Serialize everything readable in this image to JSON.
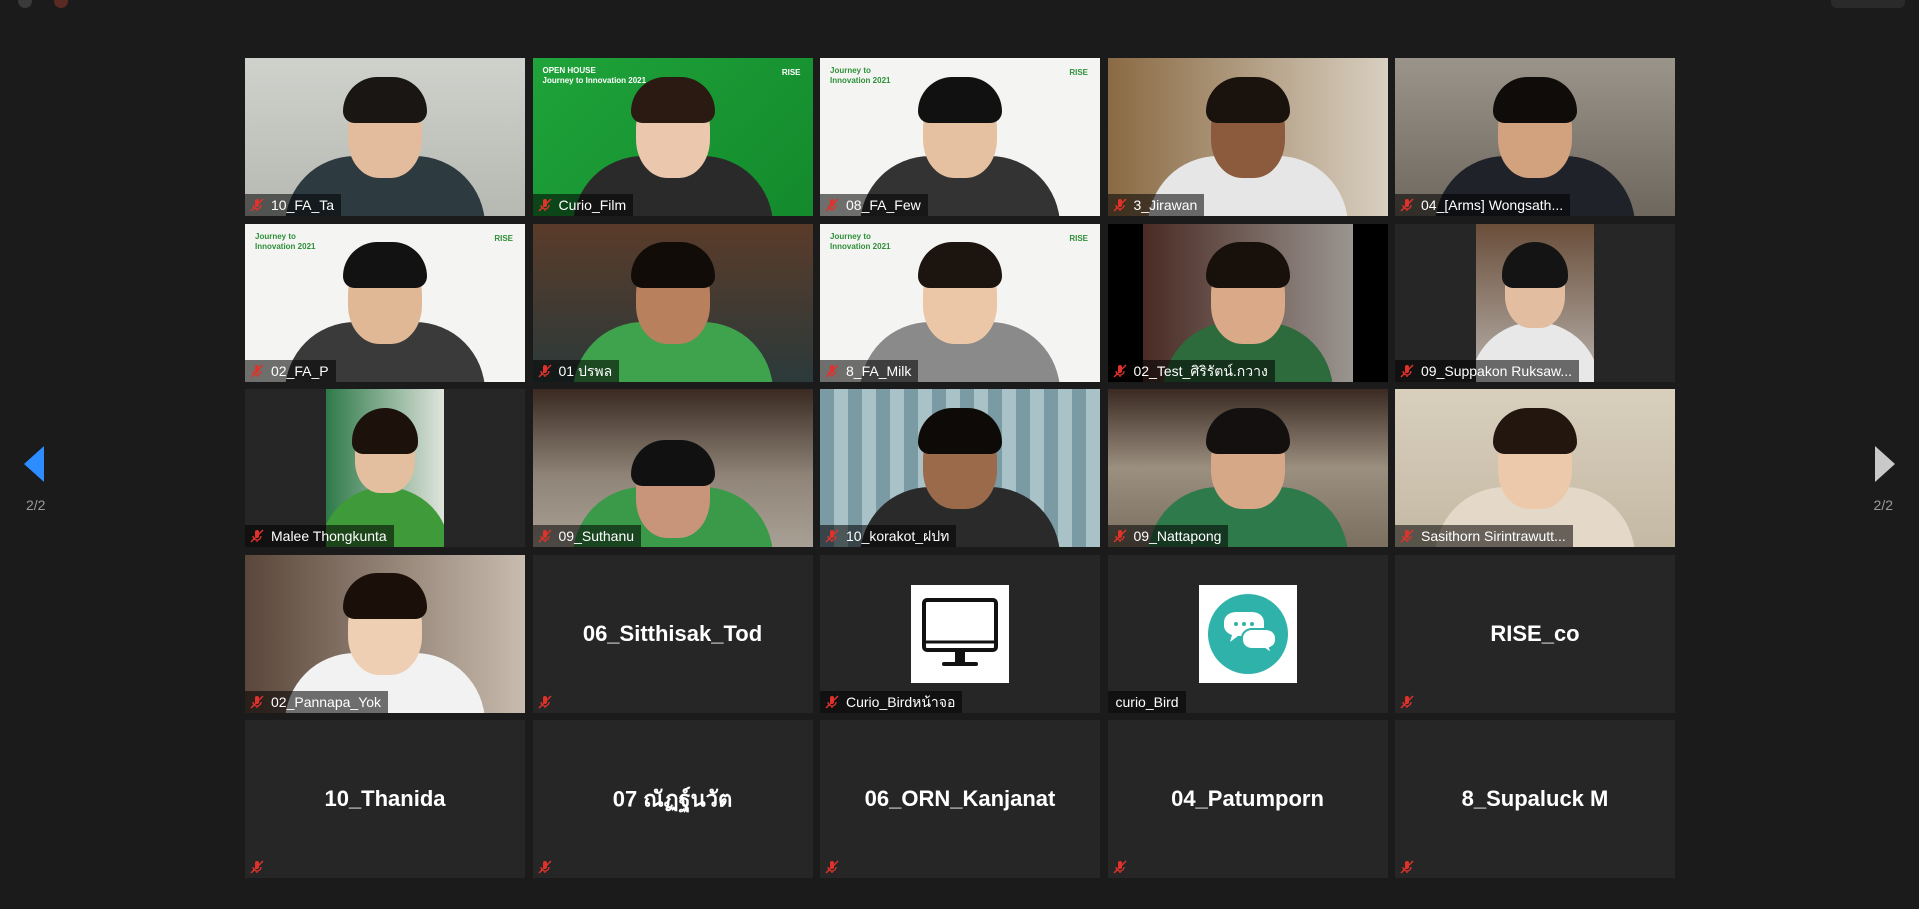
{
  "navigation": {
    "page_indicator_left": "2/2",
    "page_indicator_right": "2/2"
  },
  "colors": {
    "background": "#1b1b1b",
    "tile": "#262626",
    "mic_muted": "#e0322b",
    "nav_active": "#2d8cff",
    "nav_inactive": "#c9c9c9"
  },
  "participants": [
    {
      "name": "10_FA_Ta",
      "video": true
    },
    {
      "name": "Curio_Film",
      "video": true,
      "banner_lines": [
        "OPEN HOUSE",
        "Journey to Innovation 2021"
      ],
      "banner_logo": "RISE"
    },
    {
      "name": "08_FA_Few",
      "video": true,
      "banner_lines": [
        "Journey to",
        "Innovation 2021"
      ],
      "banner_logo": "RISE"
    },
    {
      "name": "3_Jirawan",
      "video": true
    },
    {
      "name": "04_[Arms] Wongsath...",
      "video": true
    },
    {
      "name": "02_FA_P",
      "video": true,
      "banner_lines": [
        "Journey to",
        "Innovation 2021"
      ],
      "banner_logo": "RISE"
    },
    {
      "name": "01 ปรพล",
      "video": true
    },
    {
      "name": "8_FA_Milk",
      "video": true,
      "banner_lines": [
        "Journey to",
        "Innovation 2021"
      ],
      "banner_logo": "RISE"
    },
    {
      "name": "02_Test_ศิริรัตน์.กวาง",
      "video": true
    },
    {
      "name": "09_Suppakon Ruksaw...",
      "video": true
    },
    {
      "name": "Malee Thongkunta",
      "video": true
    },
    {
      "name": "09_Suthanu",
      "video": true
    },
    {
      "name": "10_korakot_ฝปท",
      "video": true
    },
    {
      "name": "09_Nattapong",
      "video": true
    },
    {
      "name": "Sasithorn Sirintrawutt...",
      "video": true
    },
    {
      "name": "02_Pannapa_Yok",
      "video": true
    },
    {
      "name": "06_Sitthisak_Tod",
      "video": false
    },
    {
      "name": "Curio_Birdหน้าจอ",
      "video": false,
      "avatar_icon": "monitor-icon"
    },
    {
      "name": "curio_Bird",
      "video": false,
      "avatar_icon": "chat-bubbles-icon"
    },
    {
      "name": "RISE_co",
      "video": false
    },
    {
      "name": "10_Thanida",
      "video": false
    },
    {
      "name": "07 ณัฏฐ์นวัต",
      "video": false
    },
    {
      "name": "06_ORN_Kanjanat",
      "video": false
    },
    {
      "name": "04_Patumporn",
      "video": false
    },
    {
      "name": "8_Supaluck M",
      "video": false
    }
  ]
}
